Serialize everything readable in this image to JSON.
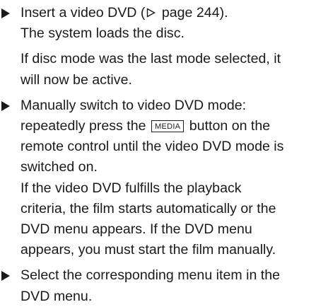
{
  "steps": [
    {
      "lines": [
        {
          "before": "Insert a video DVD (",
          "after": " page 244)."
        }
      ],
      "paragraphs": [
        [
          "The system loads the disc."
        ],
        [
          "If disc mode was the last mode selected, it",
          "will now be active."
        ]
      ]
    },
    {
      "lines_plain": [
        "Manually switch to video DVD mode:"
      ],
      "key_line": {
        "before": "repeatedly press the ",
        "key": "MEDIA",
        "after": " button on the"
      },
      "lines_after": [
        "remote control until the video DVD mode is",
        "switched on."
      ],
      "paragraphs": [
        [
          "If the video DVD fulfills the playback",
          "criteria, the film starts automatically or the",
          "DVD menu appears. If the DVD menu",
          "appears, you must start the film manually."
        ]
      ]
    },
    {
      "lines_plain": [
        "Select the corresponding menu item in the",
        "DVD menu."
      ]
    }
  ],
  "icons": {
    "bullet": "black-right-triangle-icon",
    "page_ref": "outline-right-triangle-icon"
  }
}
